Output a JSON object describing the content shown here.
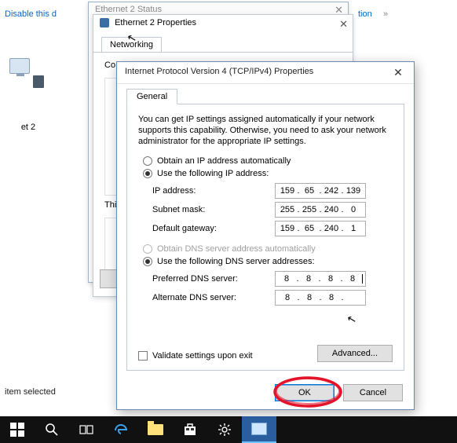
{
  "desktop": {
    "disable_link": "Disable this d",
    "tion_link": "tion",
    "more_chev": "»",
    "eth_label": "et 2",
    "status_bar": "item selected"
  },
  "win_status": {
    "title": "Ethernet 2 Status"
  },
  "win_props": {
    "title": "Ethernet 2 Properties",
    "tab": "Networking",
    "connect_label": "Co",
    "this_label": "Thi"
  },
  "dlg": {
    "title": "Internet Protocol Version 4 (TCP/IPv4) Properties",
    "tab": "General",
    "intro": "You can get IP settings assigned automatically if your network supports this capability. Otherwise, you need to ask your network administrator for the appropriate IP settings.",
    "ip": {
      "auto_label": "Obtain an IP address automatically",
      "manual_label": "Use the following IP address:",
      "ip_label": "IP address:",
      "ip_value": [
        "159",
        "65",
        "242",
        "139"
      ],
      "subnet_label": "Subnet mask:",
      "subnet_value": [
        "255",
        "255",
        "240",
        "0"
      ],
      "gateway_label": "Default gateway:",
      "gateway_value": [
        "159",
        "65",
        "240",
        "1"
      ]
    },
    "dns": {
      "auto_label": "Obtain DNS server address automatically",
      "manual_label": "Use the following DNS server addresses:",
      "pref_label": "Preferred DNS server:",
      "pref_value": [
        "8",
        "8",
        "8",
        "8"
      ],
      "alt_label": "Alternate DNS server:",
      "alt_value": [
        "8",
        "8",
        "8",
        ""
      ]
    },
    "validate_label": "Validate settings upon exit",
    "advanced_label": "Advanced...",
    "ok_label": "OK",
    "cancel_label": "Cancel"
  }
}
